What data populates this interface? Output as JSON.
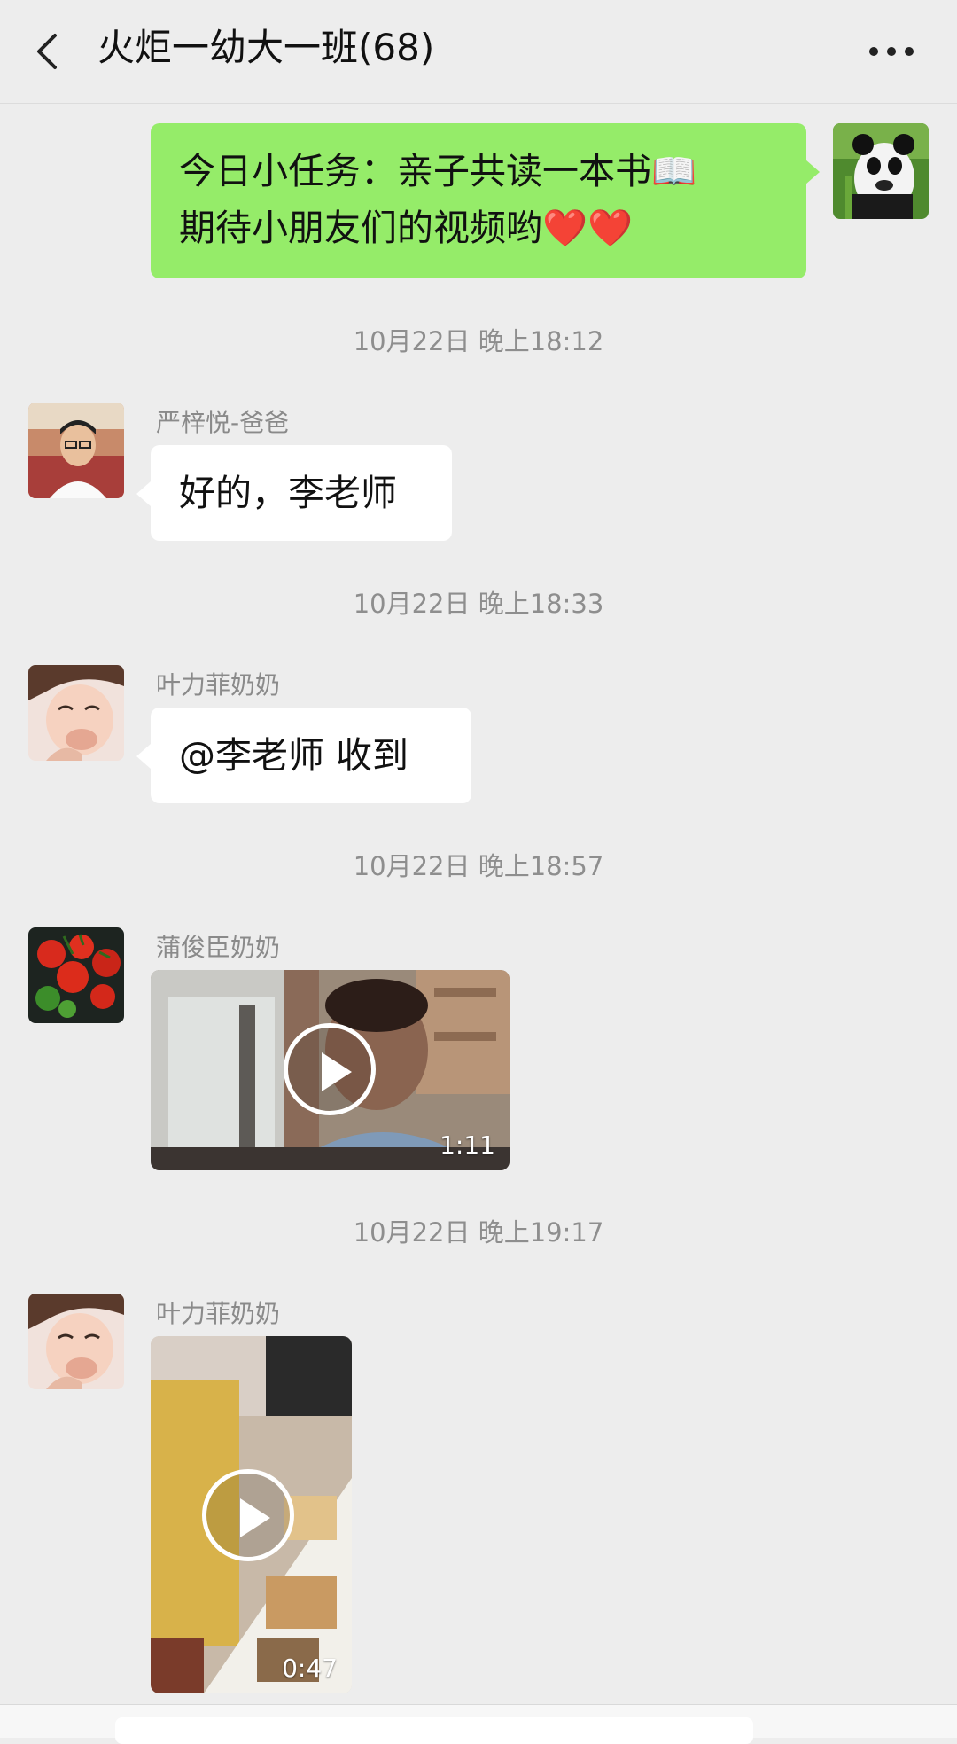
{
  "header": {
    "title": "火炬一幼大一班(68)",
    "back_icon": "chevron-left-icon",
    "more_icon": "more-dots-icon"
  },
  "messages": [
    {
      "type": "text",
      "side": "right",
      "lines": [
        "今日小任务：亲子共读一本书📖",
        "期待小朋友们的视频哟❤️❤️"
      ],
      "avatar": "panda-avatar"
    },
    {
      "type": "timestamp",
      "text": "10月22日 晚上18:12"
    },
    {
      "type": "text",
      "side": "left",
      "sender": "严梓悦-爸爸",
      "text": "好的，李老师",
      "avatar": "man-avatar"
    },
    {
      "type": "timestamp",
      "text": "10月22日 晚上18:33"
    },
    {
      "type": "text",
      "side": "left",
      "sender": "叶力菲奶奶",
      "text": "@李老师  收到",
      "avatar": "child-avatar"
    },
    {
      "type": "timestamp",
      "text": "10月22日 晚上18:57"
    },
    {
      "type": "video",
      "side": "left",
      "sender": "蒲俊臣奶奶",
      "duration": "1:11",
      "avatar": "tomato-avatar"
    },
    {
      "type": "timestamp",
      "text": "10月22日 晚上19:17"
    },
    {
      "type": "video",
      "side": "left",
      "sender": "叶力菲奶奶",
      "duration": "0:47",
      "avatar": "child-avatar"
    }
  ],
  "colors": {
    "background": "#ededed",
    "bubble_self": "#95ec69",
    "bubble_other": "#ffffff",
    "timestamp": "#8e8e8e"
  }
}
